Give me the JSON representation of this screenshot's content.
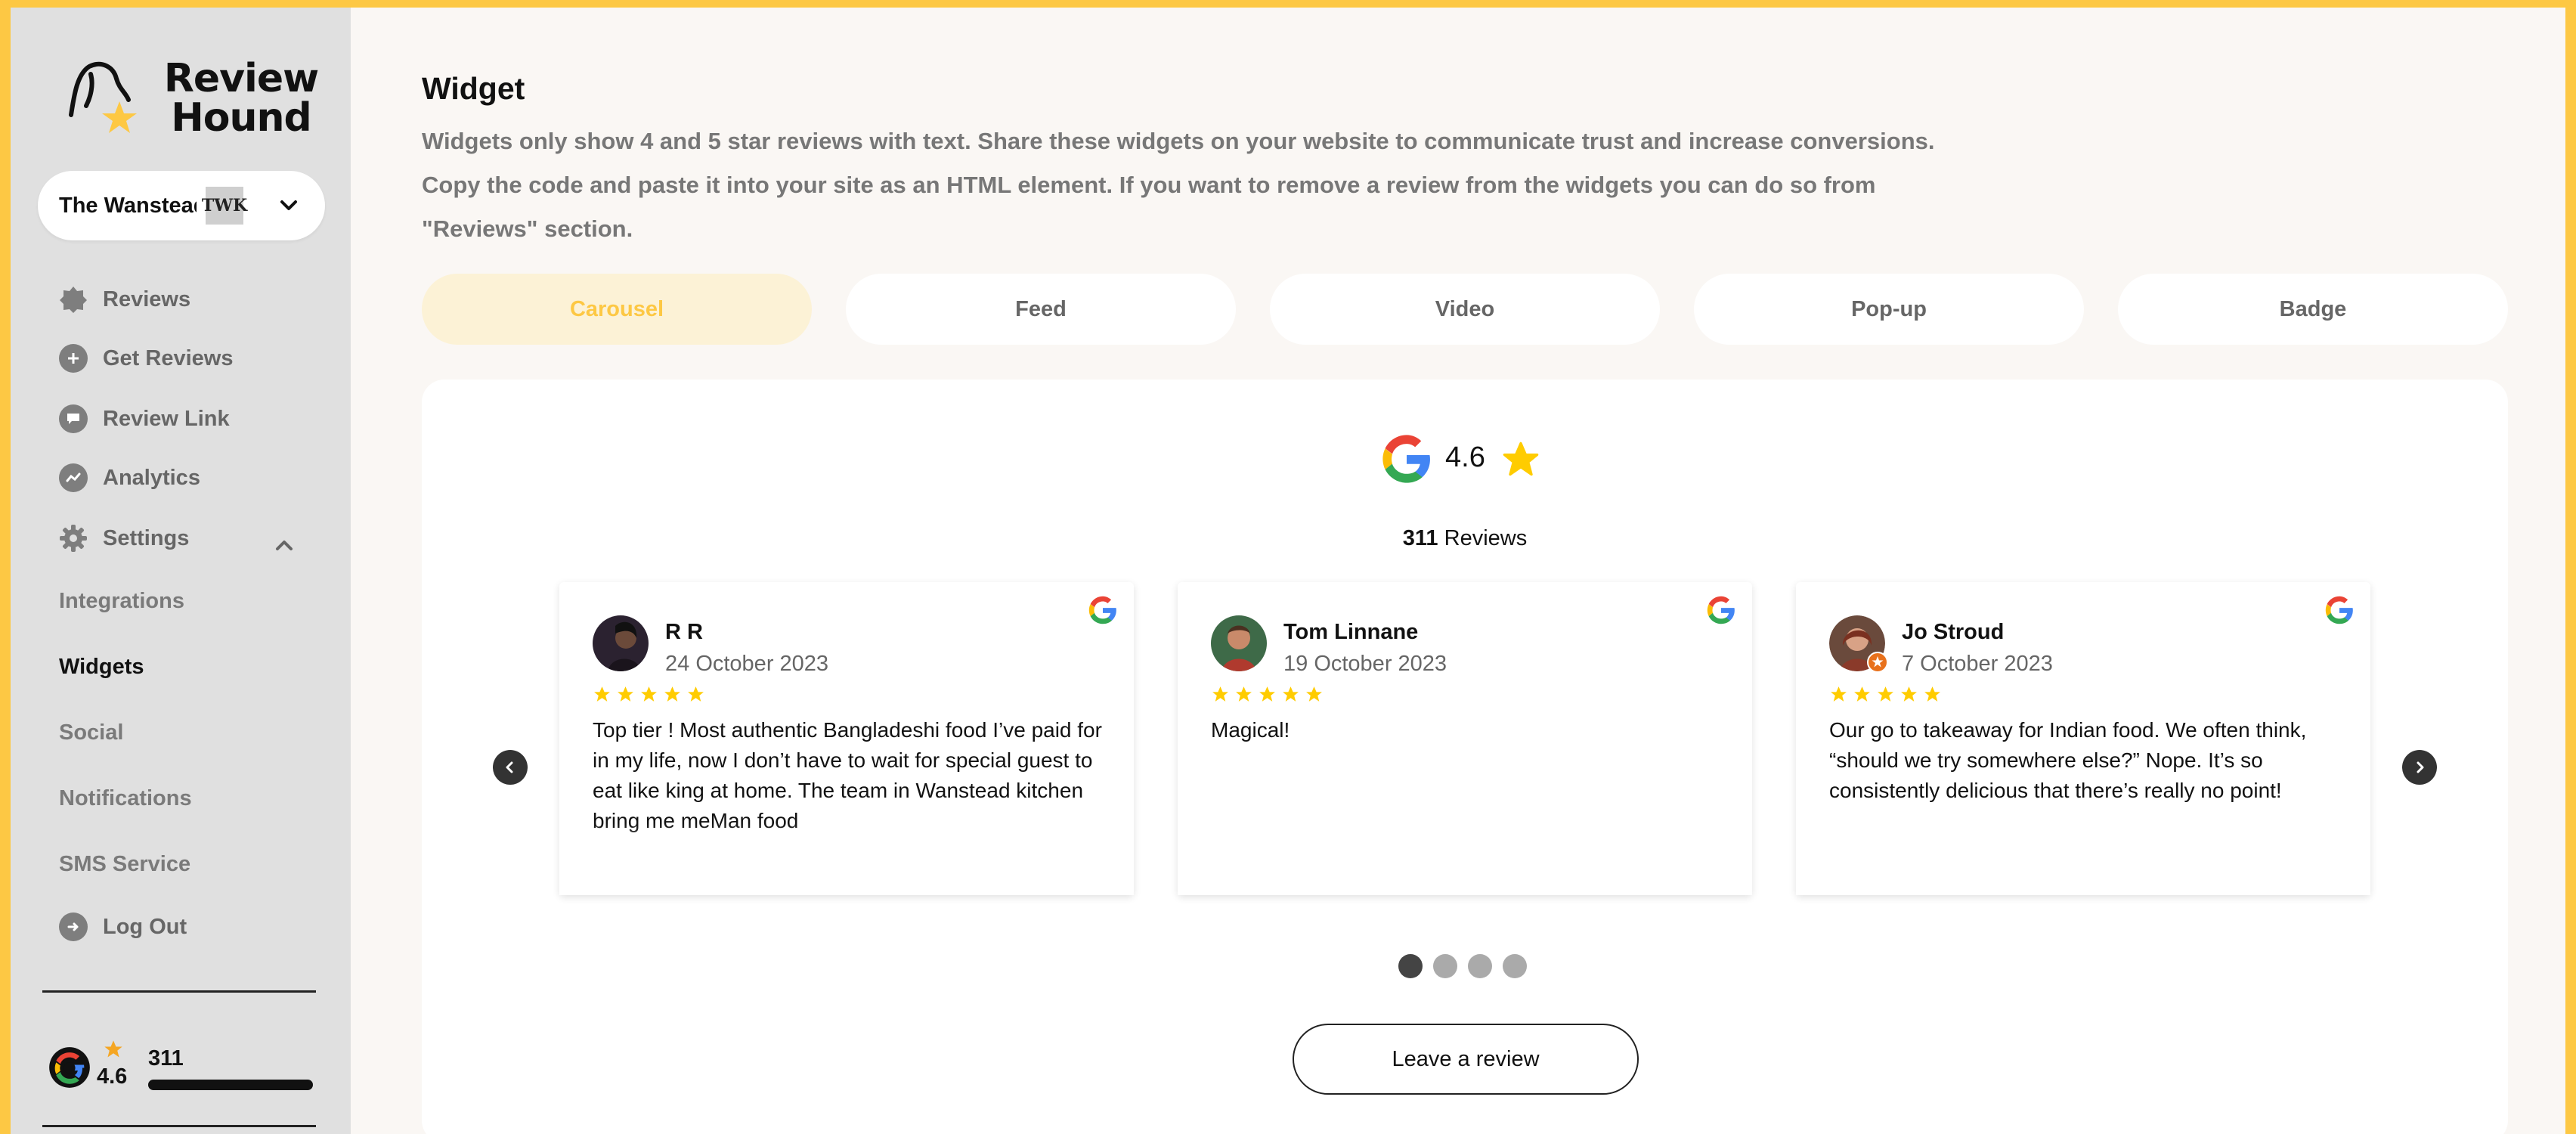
{
  "brand": {
    "name": "Review Hound",
    "accent": "#FDC844"
  },
  "venue_selector": {
    "name": "The Wanstead Kitchen",
    "logo_text": "TWK"
  },
  "sidebar": {
    "nav": [
      {
        "label": "Reviews",
        "icon": "badge-star-icon"
      },
      {
        "label": "Get Reviews",
        "icon": "plus-circle-icon"
      },
      {
        "label": "Review Link",
        "icon": "chat-bubble-icon"
      },
      {
        "label": "Analytics",
        "icon": "chart-icon"
      },
      {
        "label": "Settings",
        "icon": "gear-icon"
      }
    ],
    "settings_sub": [
      {
        "label": "Integrations"
      },
      {
        "label": "Widgets"
      },
      {
        "label": "Social"
      },
      {
        "label": "Notifications"
      },
      {
        "label": "SMS Service"
      }
    ],
    "logout": {
      "label": "Log Out",
      "icon": "logout-icon"
    },
    "mini_rating": {
      "score": "4.6",
      "count": "311",
      "fill": 1.0
    }
  },
  "main": {
    "title": "Widget",
    "description": [
      "Widgets only show 4 and 5 star reviews with text. Share these widgets on your website to communicate trust and increase conversions.",
      "Copy the code and paste it into your site as an HTML element. If you want to remove a review from the widgets you can do so from",
      "\"Reviews\" section."
    ],
    "tabs": [
      {
        "label": "Carousel",
        "active": true
      },
      {
        "label": "Feed",
        "active": false
      },
      {
        "label": "Video",
        "active": false
      },
      {
        "label": "Pop-up",
        "active": false
      },
      {
        "label": "Badge",
        "active": false
      }
    ]
  },
  "widget": {
    "rating": "4.6",
    "review_count": "311",
    "review_count_label": "Reviews",
    "reviews": [
      {
        "name": "R R",
        "date": "24 October 2023",
        "stars": 5,
        "text": "Top tier ! Most authentic Bangladeshi food I’ve paid for in my life, now I don’t have to wait for special guest to eat like king at home. The team in Wanstead kitchen bring me meMan food"
      },
      {
        "name": "Tom Linnane",
        "date": "19 October 2023",
        "stars": 5,
        "text": "Magical!"
      },
      {
        "name": "Jo Stroud",
        "date": "7 October 2023",
        "stars": 5,
        "text": "Our go to takeaway for Indian food. We often think, “should we try somewhere else?” Nope. It’s so consistently delicious that there’s really no point!"
      }
    ],
    "pagination": {
      "pages": 4,
      "current": 1
    },
    "leave_review_label": "Leave a review",
    "star_color": "#FFCC00"
  }
}
